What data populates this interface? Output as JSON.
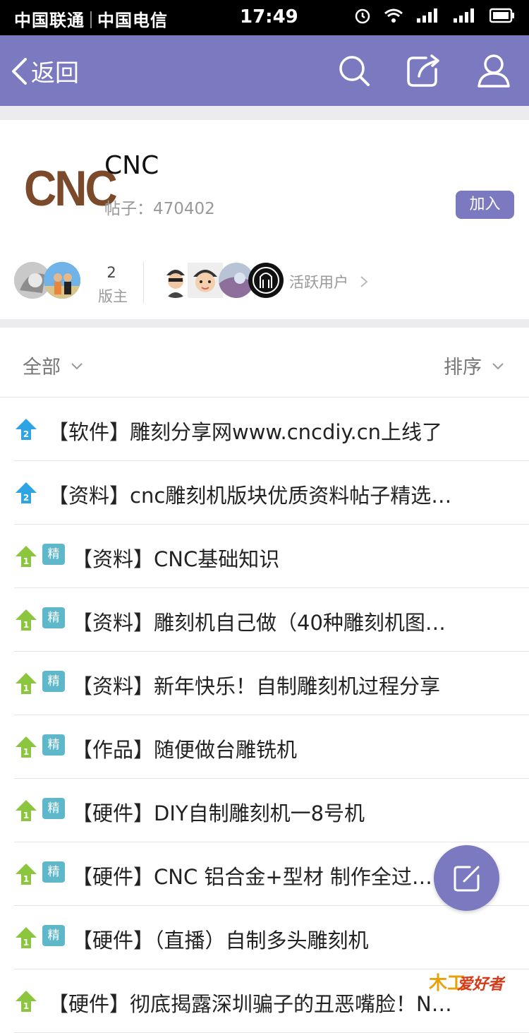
{
  "status_bar": {
    "carrier1": "中国联通",
    "carrier2": "中国电信",
    "time": "17:49"
  },
  "nav": {
    "back_label": "返回",
    "bg_color": "#7b79c0"
  },
  "forum": {
    "logo_text": "CNC",
    "name": "CNC",
    "posts_label": "帖子：470402",
    "join_label": "加入"
  },
  "moderators": {
    "count": "2",
    "label": "版主",
    "active_label": "活跃用户"
  },
  "filter": {
    "all_label": "全部",
    "sort_label": "排序"
  },
  "threads": [
    {
      "badge": "top2",
      "jing": false,
      "title": "【软件】雕刻分享网www.cncdiy.cn上线了"
    },
    {
      "badge": "top2",
      "jing": false,
      "title": "【资料】cnc雕刻机版块优质资料帖子精选…"
    },
    {
      "badge": "top1",
      "jing": true,
      "title": "【资料】CNC基础知识"
    },
    {
      "badge": "top1",
      "jing": true,
      "title": "【资料】雕刻机自己做（40种雕刻机图…"
    },
    {
      "badge": "top1",
      "jing": true,
      "title": "【资料】新年快乐！自制雕刻机过程分享"
    },
    {
      "badge": "top1",
      "jing": true,
      "title": "【作品】随便做台雕铣机"
    },
    {
      "badge": "top1",
      "jing": true,
      "title": "【硬件】DIY自制雕刻机一8号机"
    },
    {
      "badge": "top1",
      "jing": true,
      "title": "【硬件】CNC 铝合金+型材 制作全过…"
    },
    {
      "badge": "top1",
      "jing": true,
      "title": "【硬件】（直播）自制多头雕刻机"
    },
    {
      "badge": "top1",
      "jing": false,
      "title": "【硬件】彻底揭露深圳骗子的丑恶嘴脸！N…"
    }
  ],
  "jing_label": "精",
  "badge_numbers": {
    "top1": "1",
    "top2": "2"
  },
  "watermark": {
    "part1": "木工",
    "part2": "爱好者"
  }
}
